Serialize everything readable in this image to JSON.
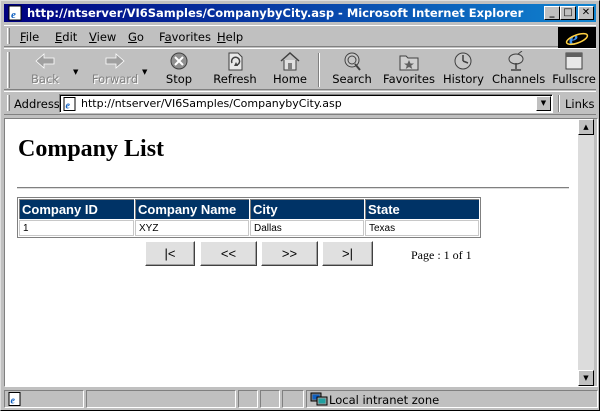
{
  "window": {
    "title": "http://ntserver/VI6Samples/CompanybyCity.asp - Microsoft Internet Explorer",
    "controls": {
      "minimize": "_",
      "maximize": "□",
      "close": "✕"
    }
  },
  "menu": {
    "items": [
      {
        "label": "File",
        "key": "F",
        "rest": "ile"
      },
      {
        "label": "Edit",
        "key": "E",
        "rest": "dit"
      },
      {
        "label": "View",
        "key": "V",
        "rest": "iew"
      },
      {
        "label": "Go",
        "key": "G",
        "rest": "o"
      },
      {
        "label": "Favorites",
        "key": "a",
        "pre": "F",
        "rest": "vorites"
      },
      {
        "label": "Help",
        "key": "H",
        "rest": "elp"
      }
    ]
  },
  "toolbar": {
    "back": "Back",
    "forward": "Forward",
    "stop": "Stop",
    "refresh": "Refresh",
    "home": "Home",
    "search": "Search",
    "favorites": "Favorites",
    "history": "History",
    "channels": "Channels",
    "fullscreen": "Fullscre"
  },
  "address": {
    "label": "Address",
    "url": "http://ntserver/VI6Samples/CompanybyCity.asp",
    "links": "Links"
  },
  "page": {
    "title": "Company List",
    "table": {
      "headers": [
        "Company ID",
        "Company Name",
        "City",
        "State"
      ],
      "rows": [
        [
          "1",
          "XYZ",
          "Dallas",
          "Texas"
        ]
      ]
    },
    "pager": {
      "first": "|<",
      "prev": "<<",
      "next": ">>",
      "last": ">|",
      "info": "Page : 1 of 1"
    }
  },
  "status": {
    "zone": "Local intranet zone"
  },
  "colors": {
    "title_bar": "#000080",
    "grid_header": "#003366",
    "chrome": "#c0c0c0"
  }
}
